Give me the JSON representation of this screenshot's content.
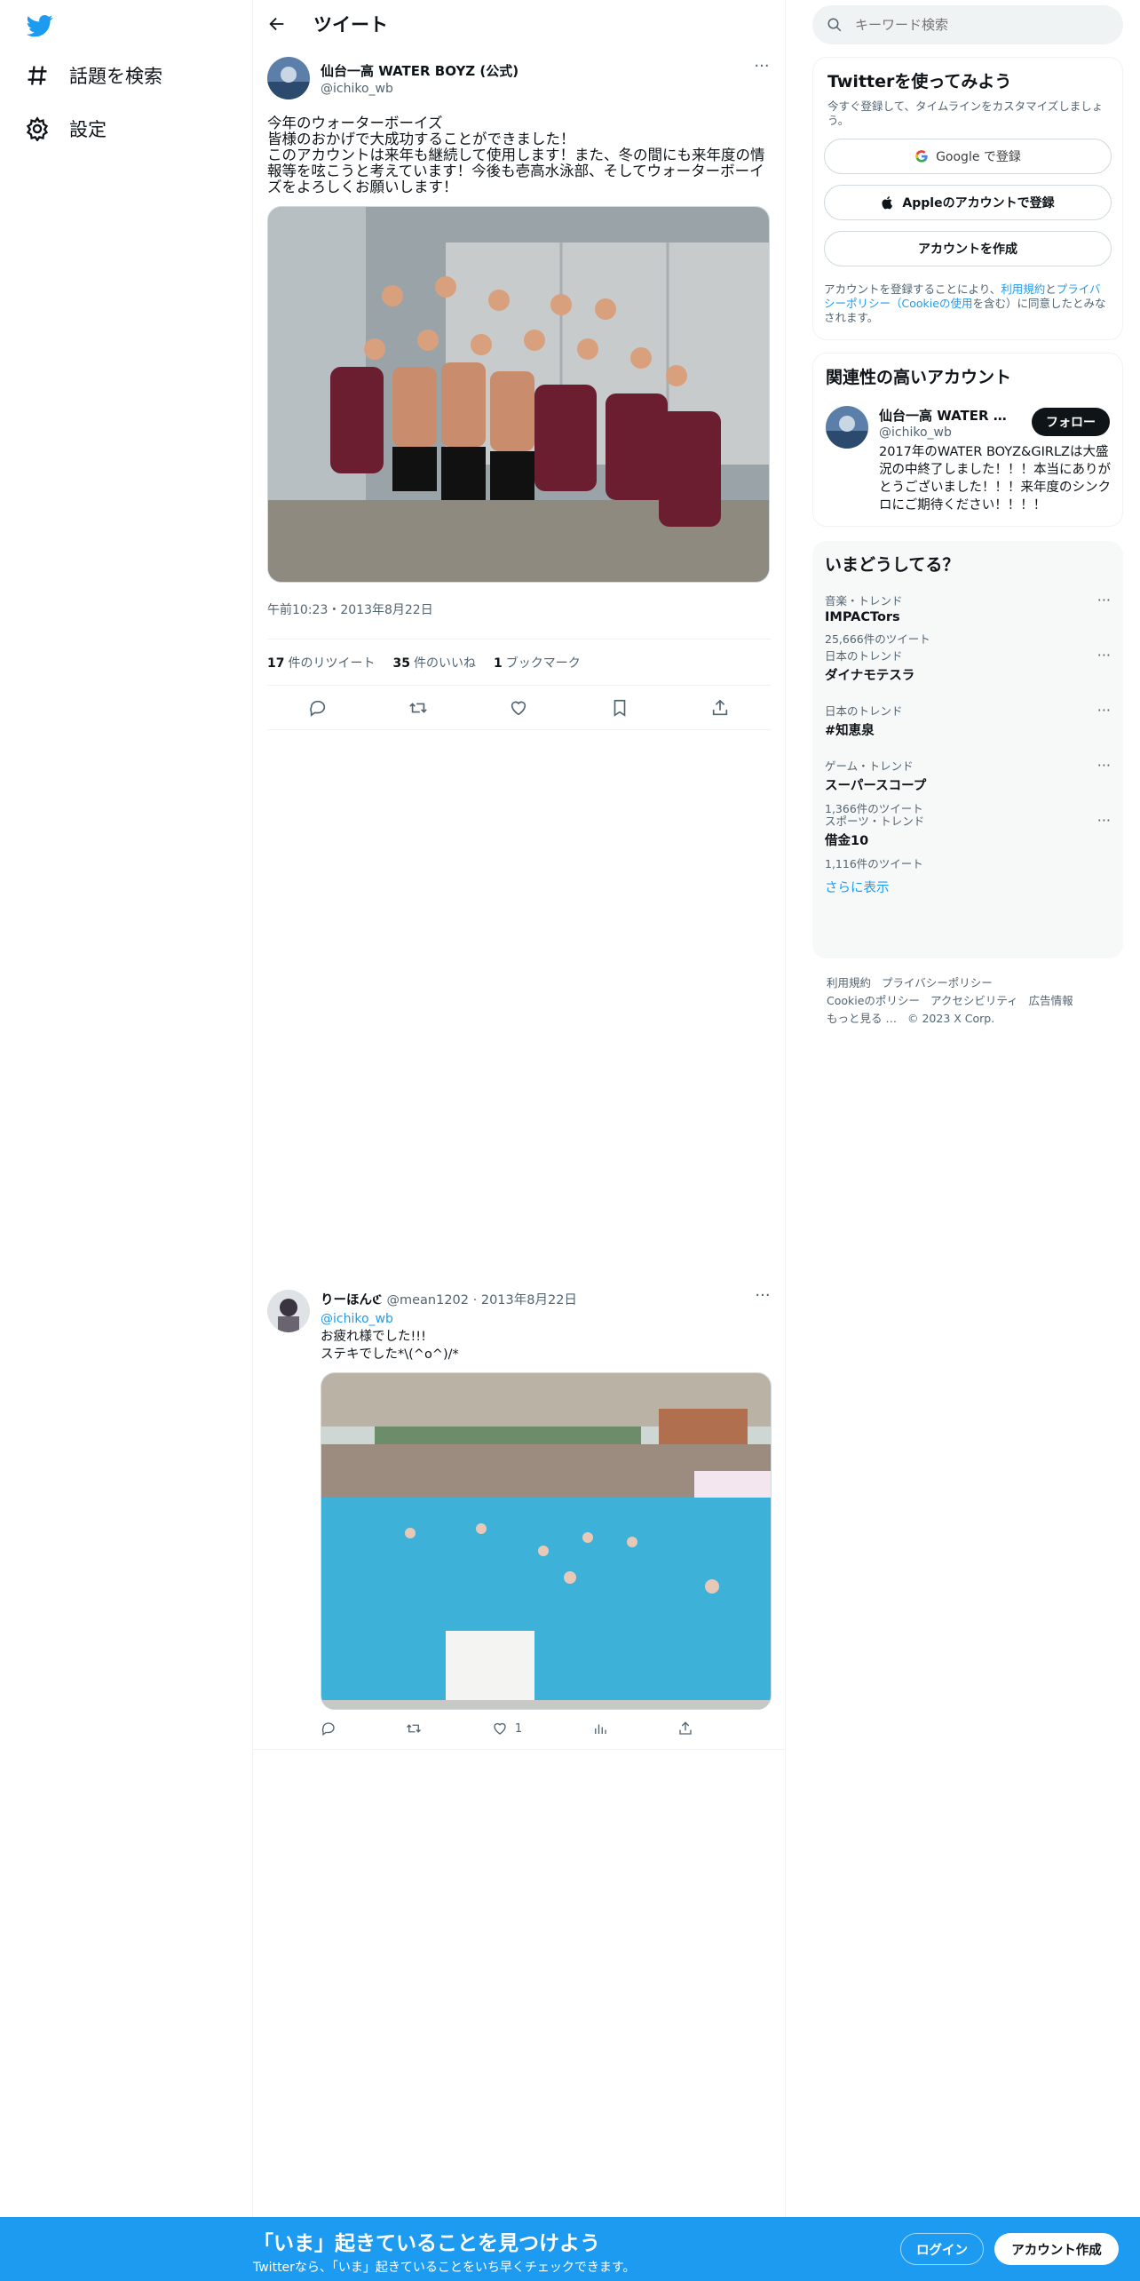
{
  "app": {
    "brand_color": "#1d9bf0",
    "icons": [
      "twitter-bird-icon",
      "hashtag-icon",
      "gear-icon"
    ]
  },
  "nav": {
    "explore_label": "話題を検索",
    "settings_label": "設定"
  },
  "header": {
    "title": "ツイート"
  },
  "tweet": {
    "author_name": "仙台一高 WATER BOYZ (公式)",
    "author_handle": "@ichiko_wb",
    "text": "今年のウォーターボーイズ\n皆様のおかげで大成功することができました！\nこのアカウントは来年も継続して使用します！また、冬の間にも来年度の情報等を呟こうと考えています！今後も壱高水泳部、そしてウォーターボーイズをよろしくお願いします！",
    "timestamp": "午前10:23・2013年8月22日",
    "retweets_count": "17",
    "retweets_label": "件のリツイート",
    "likes_count": "35",
    "likes_label": "件のいいね",
    "bookmarks_count": "1",
    "bookmarks_label": "ブックマーク"
  },
  "reply": {
    "author_name": "りーほんℭ",
    "author_handle": "@mean1202",
    "date": "2013年8月22日",
    "mention": "@ichiko_wb",
    "text": "お疲れ様でした!!!\nステキでした*\\(^o^)/*",
    "likes": "1"
  },
  "search": {
    "placeholder": "キーワード検索"
  },
  "signup": {
    "title": "Twitterを使ってみよう",
    "subtitle": "今すぐ登録して、タイムラインをカスタマイズしましょう。",
    "google_label": "Google で登録",
    "apple_label": "Appleのアカウントで登録",
    "create_label": "アカウントを作成",
    "legal_prefix": "アカウントを登録することにより、",
    "legal_terms": "利用規約",
    "legal_and": "と",
    "legal_privacy": "プライバシーポリシー",
    "legal_cookie": "（Cookieの使用",
    "legal_suffix": "を含む）に同意したとみなされます。"
  },
  "related": {
    "title": "関連性の高いアカウント",
    "name": "仙台一高 WATER BOYZ (公式)",
    "handle": "@ichiko_wb",
    "bio": "2017年のWATER BOYZ&GIRLZは大盛況の中終了しました！！！本当にありがとうございました！！！来年度のシンクロにご期待ください！！！！",
    "follow_label": "フォロー"
  },
  "trends": {
    "title": "いまどうしてる？",
    "items": [
      {
        "category": "音楽・トレンド",
        "title": "IMPACTors",
        "count": "25,666件のツイート"
      },
      {
        "category": "日本のトレンド",
        "title": "ダイナモテスラ",
        "count": ""
      },
      {
        "category": "日本のトレンド",
        "title": "#知恵泉",
        "count": ""
      },
      {
        "category": "ゲーム・トレンド",
        "title": "スーパースコープ",
        "count": "1,366件のツイート"
      },
      {
        "category": "スポーツ・トレンド",
        "title": "借金10",
        "count": "1,116件のツイート"
      }
    ],
    "show_more": "さらに表示"
  },
  "footer": {
    "terms": "利用規約",
    "privacy": "プライバシーポリシー",
    "cookie": "Cookieのポリシー",
    "accessibility": "アクセシビリティ",
    "ads": "広告情報",
    "more": "もっと見る …",
    "copyright": "© 2023 X Corp."
  },
  "banner": {
    "title": "「いま」起きていることを見つけよう",
    "subtitle": "Twitterなら、「いま」起きていることをいち早くチェックできます。",
    "login_label": "ログイン",
    "signup_label": "アカウント作成"
  }
}
